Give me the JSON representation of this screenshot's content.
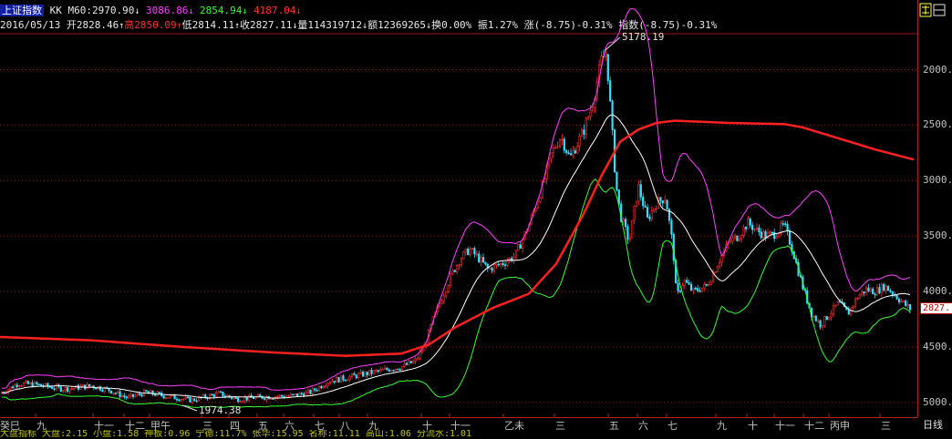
{
  "header": {
    "index_name": "上证指数",
    "kk_label": "KK",
    "m60_label": "M60:",
    "m60_value": "2970.90",
    "v2": "3086.86",
    "v3": "2854.94",
    "v4": "4187.04",
    "date": "2016/05/13",
    "open_label": "开",
    "open": "2828.46",
    "high_label": "高",
    "high": "2850.09",
    "low_label": "低",
    "low": "2814.11",
    "close_label": "收",
    "close": "2827.11",
    "vol_label": "量",
    "vol": "114319712",
    "amt_label": "额",
    "amt": "12369265",
    "turn_label": "换",
    "turn": "0.00%",
    "amp_label": "振",
    "amp": "1.27%",
    "chg_label": "涨",
    "chg": "(-8.75)-0.31%",
    "idx_label": "指数",
    "idx_chg": "(-8.75)-0.31%",
    "up_arrow": "↑",
    "down_arrow": "↓"
  },
  "y_axis": {
    "ticks": [
      "5000.",
      "4500.",
      "4000.",
      "3500.",
      "3000.",
      "2500.",
      "2000."
    ],
    "current_price": "2827."
  },
  "x_axis": {
    "labels": [
      "癸巳",
      "九",
      "十一",
      "十二",
      "甲午",
      "三",
      "四",
      "五",
      "六",
      "七",
      "八",
      "九",
      "十",
      "十一",
      "乙未",
      "三",
      "五",
      "六",
      "七",
      "九",
      "十",
      "十一",
      "十二",
      "丙申",
      "三"
    ],
    "period_button": "日线"
  },
  "annotations": {
    "peak": "5178.19",
    "low": "1974.38"
  },
  "bottom_strip": "大盘指标 大盘:2.15 小盘:1.58 神板:0.96 宁德:11.7% 张华:15.95 名称:11.11 高山:1.06 分流水:1.01",
  "chart_data": {
    "type": "candlestick",
    "title": "上证指数",
    "ylim": [
      1900,
      5300
    ],
    "yticks": [
      2000,
      2500,
      3000,
      3500,
      4000,
      4500,
      5000
    ],
    "series": [
      {
        "name": "M60",
        "color": "#ff2020"
      },
      {
        "name": "MA",
        "color": "#ffffff"
      },
      {
        "name": "upper",
        "color": "#ff40ff"
      },
      {
        "name": "lower",
        "color": "#30ff30"
      }
    ],
    "peak_value": 5178.19,
    "low_value": 1974.38,
    "last_close": 2827.11
  }
}
